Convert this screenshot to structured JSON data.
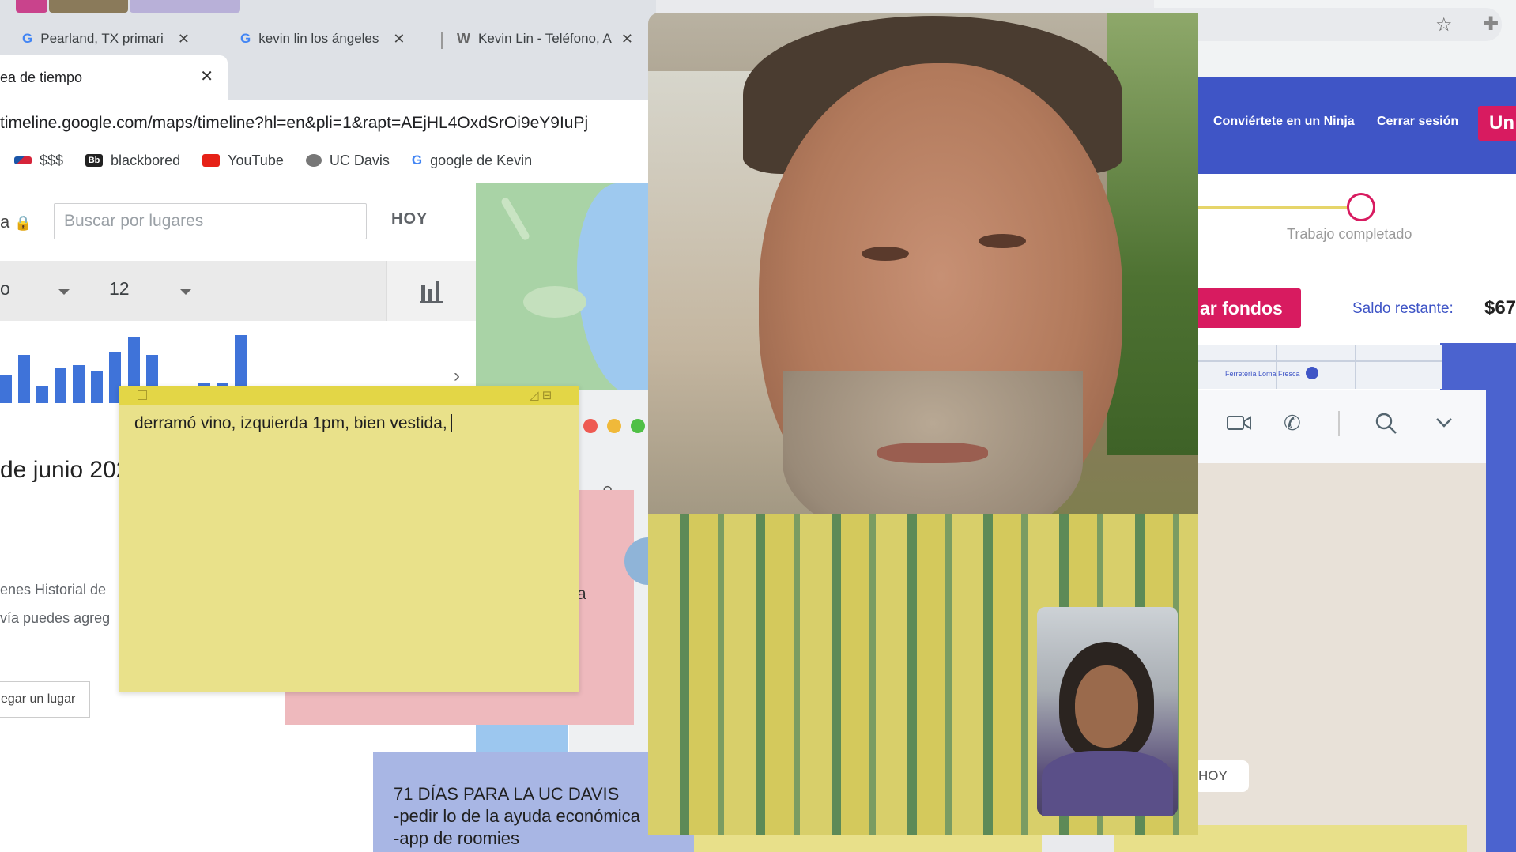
{
  "browser": {
    "tabs": [
      {
        "label": "Pearland, TX primari",
        "icon": "google-icon"
      },
      {
        "label": "kevin lin los ángeles",
        "icon": "google-icon"
      },
      {
        "label": "Kevin Lin - Teléfono, A",
        "icon": "w-icon"
      }
    ],
    "tab_close": "✕",
    "active_tab": {
      "label": "ea de tiempo",
      "close": "✕"
    },
    "url": "timeline.google.com/maps/timeline?hl=en&pli=1&rapt=AEjHL4OxdSrOi9eY9IuPj",
    "bookmarks": [
      {
        "label": "$$$",
        "icon": "bank-icon",
        "color": "#d6243a"
      },
      {
        "label": "blackbored",
        "icon": "bb-icon",
        "color": "#222222"
      },
      {
        "label": "YouTube",
        "icon": "youtube-icon",
        "color": "#e62117"
      },
      {
        "label": "UC Davis",
        "icon": "ucdavis-icon",
        "color": "#555555"
      },
      {
        "label": "google de Kevin",
        "icon": "google-icon",
        "color": "#4285f4"
      }
    ]
  },
  "timeline": {
    "title_fragment": "a",
    "search_placeholder": "Buscar por lugares",
    "today_button": "HOY",
    "month_fragment": "o",
    "day_value": "12",
    "bar_values": [
      22,
      38,
      14,
      28,
      30,
      25,
      40,
      52,
      38,
      10,
      16,
      16,
      54
    ],
    "day_heading": "de junio 202",
    "empty_msg_1": "enes Historial de",
    "empty_msg_2": "vía puedes agreg",
    "add_place_button": "egar un lugar"
  },
  "ninja": {
    "nav_ninja": "Conviértete en un Ninja",
    "nav_logout": "Cerrar sesión",
    "nav_cta": "Un",
    "progress_label": "Trabajo completado",
    "add_funds_button": "ar fondos",
    "balance_label": "Saldo restante:",
    "balance_value": "$67",
    "map_label": "Ferretería Loma Fresca"
  },
  "whatsapp": {
    "today_chip": "HOY"
  },
  "sticky_note": {
    "text": "derramó vino, izquierda 1pm, bien vestida,"
  },
  "pink_note": {
    "text": "a"
  },
  "purple_note": {
    "line1": "71 DÍAS PARA LA UC DAVIS",
    "line2": "-pedir lo de la ayuda económica",
    "line3": "-app de roomies"
  },
  "colors": {
    "sticky_yellow": "#e9e18a",
    "ninja_blue": "#3f55c6",
    "ninja_pink": "#d81b60",
    "chart_blue": "#3f73d9"
  }
}
